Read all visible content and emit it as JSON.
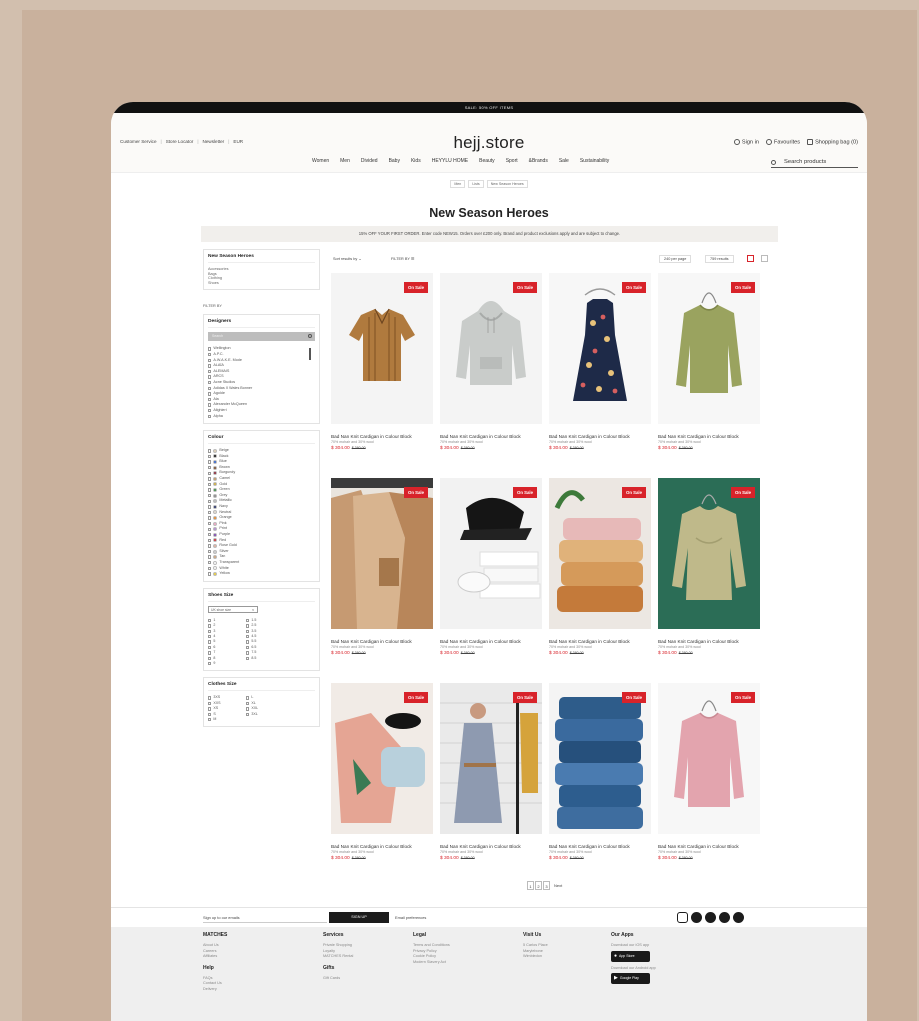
{
  "promo_bar": "SALE: 50% OFF ITEMS",
  "header": {
    "left_links": [
      "Customer Service",
      "Store Locator",
      "Newsletter",
      "EUR"
    ],
    "logo": "hejj.store",
    "sign_in": "Sign in",
    "favourites": "Favourites",
    "bag": "Shopping bag (0)"
  },
  "nav": {
    "items": [
      "Women",
      "Men",
      "Divided",
      "Baby",
      "Kids",
      "HEYYLU HOME",
      "Beauty",
      "Sport",
      "&Brands",
      "Sale",
      "Sustainability"
    ],
    "search_placeholder": "Search products"
  },
  "breadcrumb": [
    "Men",
    "Lists",
    "New Season Heroes"
  ],
  "page_title": "New Season Heroes",
  "offer": "15% OFF YOUR FIRST ORDER. Enter code NEW15. Orders over £200 only. Brand and product exclusions apply and are subject to change.",
  "sidebar": {
    "category_title": "New Season Heroes",
    "categories": [
      "Accessories",
      "Bags",
      "Clothing",
      "Shoes"
    ],
    "filter_by": "FILTER BY",
    "designers_title": "Designers",
    "designer_search_placeholder": "Search",
    "designers": [
      "Wellington",
      "A.P.C.",
      "A.W.A.K.E. Mode",
      "ALAÏA",
      "ALEMAIS",
      "ARCS",
      "Acne Studios",
      "Adidas X Wales Bonner",
      "Agolde",
      "Ala",
      "Alexander McQueen",
      "Alighieri",
      "Alpha"
    ],
    "colour_title": "Colour",
    "colours": [
      {
        "name": "Beige",
        "hex": "#e3d3b8"
      },
      {
        "name": "Black",
        "hex": "#111111"
      },
      {
        "name": "Blue",
        "hex": "#2a5fd2"
      },
      {
        "name": "Brown",
        "hex": "#7a4b2a"
      },
      {
        "name": "Burgundy",
        "hex": "#8c1d2e"
      },
      {
        "name": "Camel",
        "hex": "#c69a62"
      },
      {
        "name": "Gold",
        "hex": "#d4af37"
      },
      {
        "name": "Green",
        "hex": "#2f8f3a"
      },
      {
        "name": "Grey",
        "hex": "#8a8a8a"
      },
      {
        "name": "Metallic",
        "hex": "#c0c0c0"
      },
      {
        "name": "Navy",
        "hex": "#1f2a66"
      },
      {
        "name": "Neutral",
        "hex": "#e6dfd4"
      },
      {
        "name": "Orange",
        "hex": "#f08a24"
      },
      {
        "name": "Pink",
        "hex": "#f3a6c4"
      },
      {
        "name": "Print",
        "hex": "#b58bd6"
      },
      {
        "name": "Purple",
        "hex": "#7b3fb5"
      },
      {
        "name": "Red",
        "hex": "#d8232a"
      },
      {
        "name": "Rose Gold",
        "hex": "#e8b3a1"
      },
      {
        "name": "Silver",
        "hex": "#d2d2d2"
      },
      {
        "name": "Tan",
        "hex": "#d1a57a"
      },
      {
        "name": "Transparent",
        "hex": "#ffffff"
      },
      {
        "name": "White",
        "hex": "#ffffff"
      },
      {
        "name": "Yellow",
        "hex": "#f2d233"
      }
    ],
    "shoes_title": "Shoes Size",
    "shoes_select": "UK shoe size",
    "shoe_sizes": [
      "1",
      "1.5",
      "2",
      "2.5",
      "3",
      "3.5",
      "4",
      "4.5",
      "5",
      "5.5",
      "6",
      "6.5",
      "7",
      "7.5",
      "8",
      "8.5",
      "9"
    ],
    "clothes_title": "Clothes Size",
    "clothes_sizes": [
      "3XS",
      "L",
      "XXS",
      "XL",
      "XS",
      "XXL",
      "S",
      "3XL",
      "M"
    ]
  },
  "toolbar": {
    "sort": "Sort results by",
    "filter": "FILTER BY",
    "per_page": "240 per page",
    "results": "759 results"
  },
  "product": {
    "badge": "On Sale",
    "name": "Bad Nan Knit Cardigan in Colour Block",
    "desc": "70% mohair and 30% wool",
    "price": "$ 304.00",
    "old_price": "$ 380.00"
  },
  "pagination": {
    "pages": [
      "1",
      "2",
      "3"
    ],
    "next": "Next"
  },
  "footer": {
    "newsletter_label": "Sign up to our emails",
    "signup": "SIGN UP",
    "prefs": "Email preferences",
    "cols": [
      {
        "title": "MATCHES",
        "links": [
          "About Us",
          "Careers",
          "Affiliates"
        ],
        "title2": "Help",
        "links2": [
          "FAQs",
          "Contact Us",
          "Delivery"
        ]
      },
      {
        "title": "Services",
        "links": [
          "Private Shopping",
          "Loyalty",
          "MATCHES Rental"
        ],
        "title2": "Gifts",
        "links2": [
          "Gift Cards"
        ]
      },
      {
        "title": "Legal",
        "links": [
          "Terms and Conditions",
          "Privacy Policy",
          "Cookie Policy",
          "Modern Slavery Act"
        ]
      },
      {
        "title": "Visit Us",
        "links": [
          "5 Carlos Place",
          "Marylebone",
          "Wimbledon"
        ]
      }
    ],
    "apps_title": "Our Apps",
    "ios_text": "Download our iOS app",
    "app_store": "App Store",
    "android_text": "Download our Android app",
    "google_play": "Google Play"
  }
}
